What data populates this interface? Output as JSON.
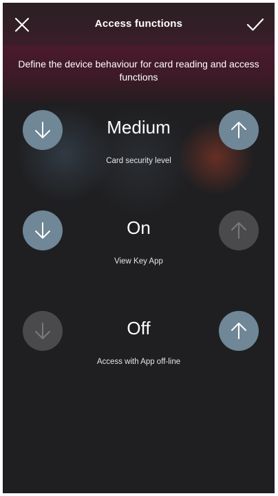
{
  "header": {
    "title": "Access functions",
    "close_icon": "close-icon",
    "confirm_icon": "checkmark-icon"
  },
  "banner": {
    "text": "Define the device behaviour for card reading and access functions"
  },
  "settings": [
    {
      "value": "Medium",
      "label": "Card security level",
      "decrease_enabled": true,
      "increase_enabled": true
    },
    {
      "value": "On",
      "label": "View Key App",
      "decrease_enabled": true,
      "increase_enabled": false
    },
    {
      "value": "Off",
      "label": "Access with App off-line",
      "decrease_enabled": false,
      "increase_enabled": true
    }
  ],
  "colors": {
    "background": "#1f1f21",
    "banner": "#4a1a2c",
    "button_active": "#6f8797",
    "button_disabled": "#4a4a4c"
  }
}
